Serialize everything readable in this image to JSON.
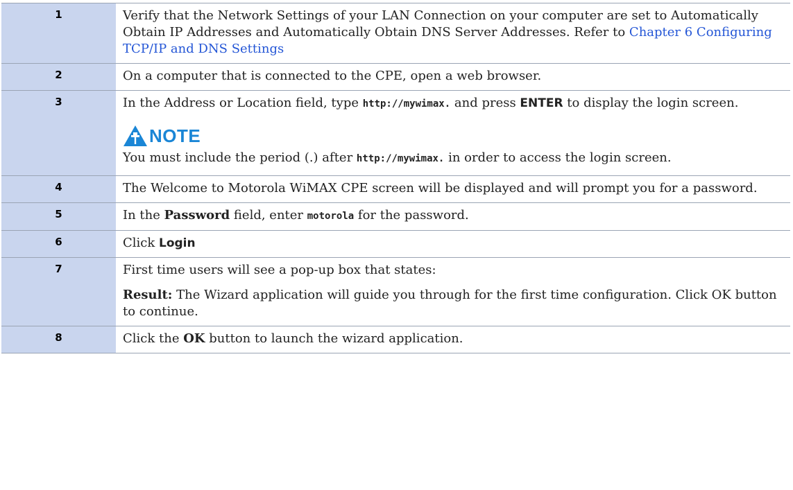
{
  "colors": {
    "number_cell_bg": "#c9d5ee",
    "link": "#2456d6",
    "note_accent": "#1a86d6",
    "border": "#9aa4b4"
  },
  "steps": [
    {
      "number": "1",
      "text_before": "Verify that the Network Settings of your LAN Connection on your computer are set to Automatically Obtain IP Addresses and Automatically Obtain DNS Server Addresses. Refer to ",
      "link": "Chapter 6 Configuring TCP/IP and DNS Settings"
    },
    {
      "number": "2",
      "text": "On a computer that is connected to the CPE, open a web browser."
    },
    {
      "number": "3",
      "text_1": "In the Address or Location field, type ",
      "code": "http://mywimax.",
      "text_2": " and press ",
      "key": "ENTER",
      "text_3": " to display the login screen.",
      "note": {
        "icon": "warning-pin-icon",
        "title": "NOTE",
        "text_1": "You must include the period (.) after ",
        "code": "http://mywimax.",
        "text_2": " in order to access the login screen."
      }
    },
    {
      "number": "4",
      "text": "The Welcome to Motorola WiMAX CPE screen will be displayed and will prompt you for a password."
    },
    {
      "number": "5",
      "text_1": "In the ",
      "bold": "Password",
      "text_2": " field, enter ",
      "code": "motorola",
      "text_3": " for the password."
    },
    {
      "number": "6",
      "text_1": "Click ",
      "bold": "Login"
    },
    {
      "number": "7",
      "text": "First time users will see a pop-up box that states:",
      "result_label": "Result:",
      "result_text": " The Wizard application will guide you through for the first time configuration. Click OK button to continue."
    },
    {
      "number": "8",
      "text_1": "Click the ",
      "bold": "OK",
      "text_2": " button to launch the wizard application."
    }
  ]
}
